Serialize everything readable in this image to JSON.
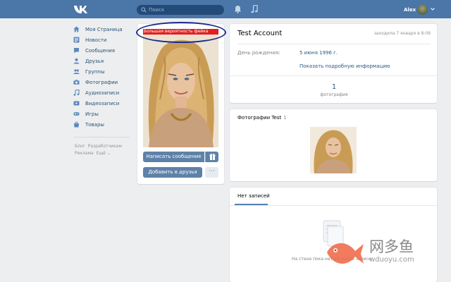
{
  "header": {
    "search_placeholder": "Поиск",
    "user_name": "Alex",
    "icons": [
      "vk-logo-icon",
      "search-icon",
      "bell-icon",
      "music-icon",
      "chevron-down-icon"
    ],
    "bg_color": "#4a76a8"
  },
  "sidebar": {
    "items": [
      {
        "label": "Моя Страница",
        "icon": "home-icon"
      },
      {
        "label": "Новости",
        "icon": "news-icon"
      },
      {
        "label": "Сообщения",
        "icon": "message-icon"
      },
      {
        "label": "Друзья",
        "icon": "friends-icon"
      },
      {
        "label": "Группы",
        "icon": "groups-icon"
      },
      {
        "label": "Фотографии",
        "icon": "camera-icon"
      },
      {
        "label": "Аудиозаписи",
        "icon": "music-icon"
      },
      {
        "label": "Видеозаписи",
        "icon": "video-icon"
      },
      {
        "label": "Игры",
        "icon": "gamepad-icon"
      },
      {
        "label": "Товары",
        "icon": "bag-icon"
      }
    ],
    "footer_links": [
      "Блог",
      "Разработчикам",
      "Реклама",
      "Ещё ⌄"
    ]
  },
  "profile": {
    "warning_label": "Большая вероятность фейка",
    "write_message_label": "Написать сообщение",
    "add_friend_label": "Добавить в друзья",
    "more_label": "···",
    "name": "Test Account",
    "last_seen": "заходила 7 января в 8:09",
    "birthday_label": "День рождения:",
    "birthday_value": "5 июня 1996 г.",
    "more_info_label": "Показать подробную информацию",
    "photo_count": "1",
    "photo_count_label": "фотография"
  },
  "photos_block": {
    "title": "Фотографии Test",
    "count": "1"
  },
  "wall": {
    "tab_label": "Нет записей",
    "empty_text": "На стене пока нет ни одной записи"
  },
  "watermark": {
    "cn": "网多鱼",
    "url": "wduoyu.com"
  }
}
